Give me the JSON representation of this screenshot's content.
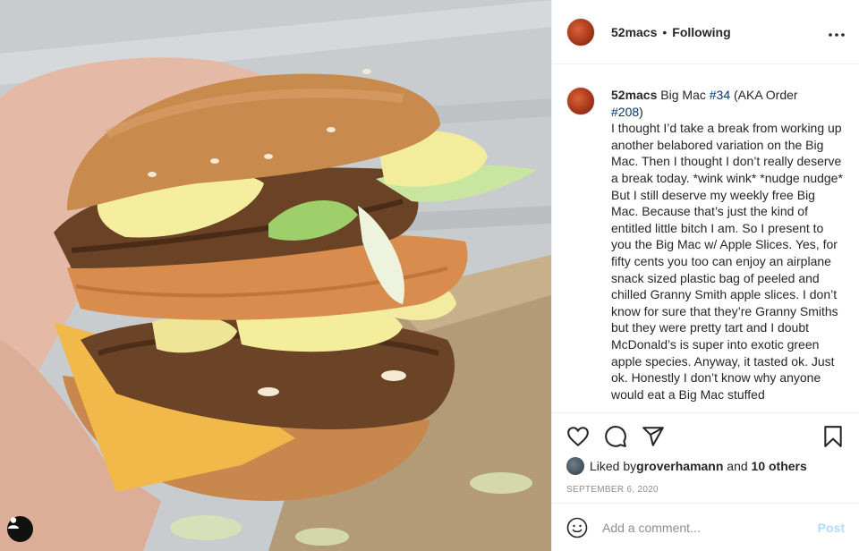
{
  "post": {
    "username": "52macs",
    "separator": "•",
    "follow_state": "Following",
    "more_icon": "more-horizontal-icon",
    "caption": {
      "username": "52macs",
      "text_a": " Big Mac ",
      "tag_a": "#34",
      "text_b": " (AKA Order ",
      "tag_b": "#208",
      "text_c": ")",
      "body": "I thought I’d take a break from working up another belabored variation on the Big Mac. Then I thought I don’t really deserve a break today. *wink wink* *nudge nudge* But I still deserve my weekly free Big Mac. Because that’s just the kind of entitled little bitch I am. So I present to you the Big Mac w/ Apple Slices. Yes, for fifty cents you too can enjoy an airplane snack sized plastic bag of peeled and chilled Granny Smith apple slices. I don’t know for sure that they’re Granny Smiths but they were pretty tart and I doubt McDonald’s is super into exotic green apple species. Anyway, it tasted ok. Just ok. Honestly I don’t know why anyone would eat a Big Mac stuffed"
    },
    "likes": {
      "prefix": "Liked by ",
      "user": "groverhamann",
      "joiner": " and ",
      "others": "10 others"
    },
    "date": "SEPTEMBER 6, 2020",
    "comment": {
      "placeholder": "Add a comment...",
      "post_label": "Post"
    },
    "icons": [
      "heart-icon",
      "comment-icon",
      "share-icon",
      "bookmark-icon",
      "emoji-icon",
      "user-tag-icon"
    ],
    "colors": {
      "link": "#00376b",
      "post_disabled": "#b3dbff",
      "muted": "#8e8e8e"
    }
  }
}
